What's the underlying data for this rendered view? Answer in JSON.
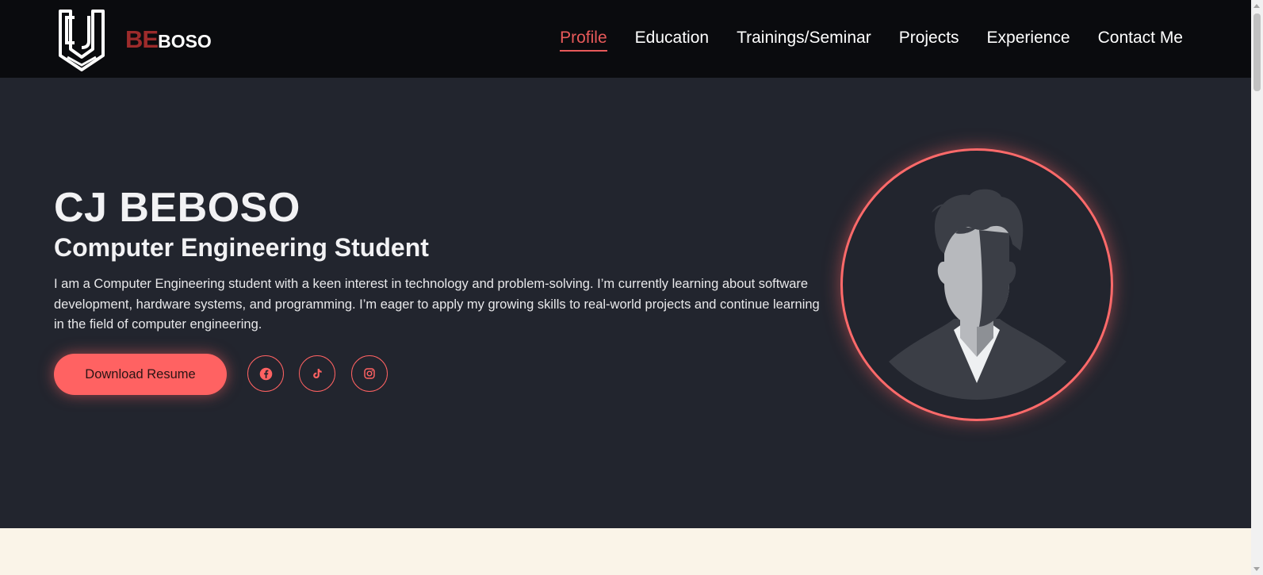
{
  "brand": {
    "logo_icon": "cj-shield-logo-icon",
    "name_accent": "BE",
    "name_rest": "BOSO"
  },
  "nav": {
    "items": [
      {
        "label": "Profile",
        "active": true
      },
      {
        "label": "Education",
        "active": false
      },
      {
        "label": "Trainings/Seminar",
        "active": false
      },
      {
        "label": "Projects",
        "active": false
      },
      {
        "label": "Experience",
        "active": false
      },
      {
        "label": "Contact Me",
        "active": false
      }
    ]
  },
  "hero": {
    "name": "CJ BEBOSO",
    "role": "Computer Engineering Student",
    "bio": "I am a Computer Engineering student with a keen interest in technology and problem-solving. I’m currently learning about software development, hardware systems, and programming. I’m eager to apply my growing skills to real-world projects and continue learning in the field of computer engineering.",
    "resume_button": "Download Resume",
    "socials": [
      {
        "icon": "facebook-icon"
      },
      {
        "icon": "tiktok-icon"
      },
      {
        "icon": "instagram-icon"
      }
    ],
    "avatar_icon": "person-silhouette-icon"
  },
  "colors": {
    "accent": "#ff6262",
    "brand_red": "#9c2b2b",
    "header_bg": "#0a0b0e",
    "hero_bg": "#22252e",
    "section_bg": "#faf4e8"
  }
}
